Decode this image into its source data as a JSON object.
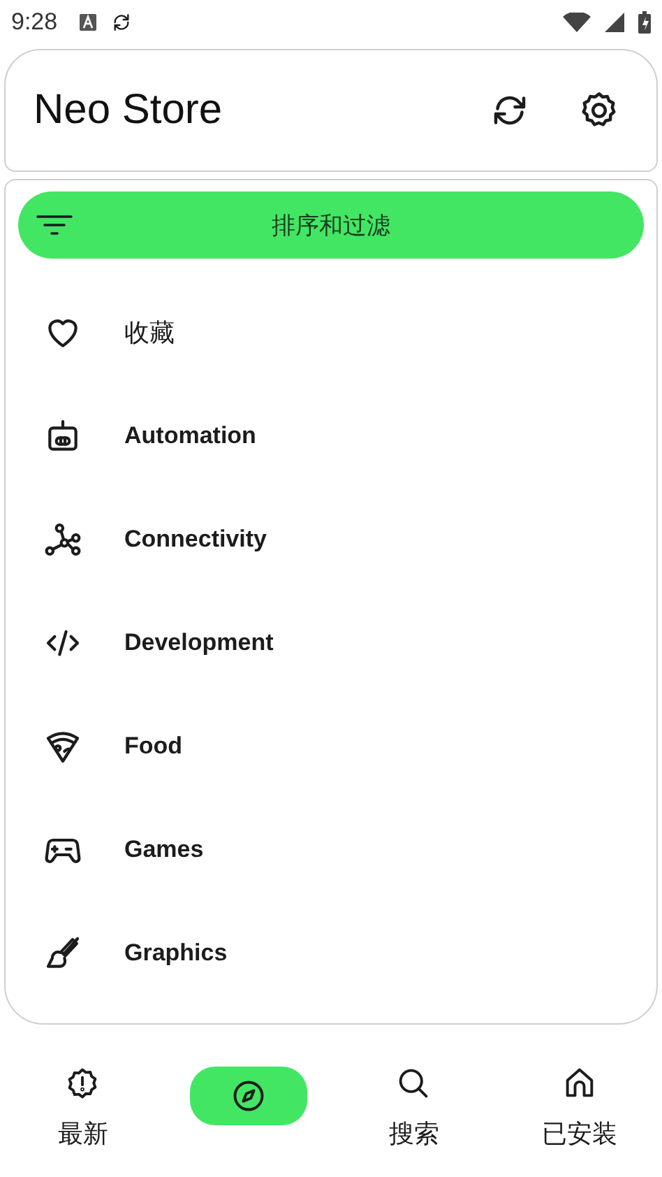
{
  "status_bar": {
    "time": "9:28"
  },
  "app_bar": {
    "title": "Neo Store"
  },
  "sort_button": {
    "label": "排序和过滤"
  },
  "categories": [
    {
      "label": "收藏"
    },
    {
      "label": "Automation"
    },
    {
      "label": "Connectivity"
    },
    {
      "label": "Development"
    },
    {
      "label": "Food"
    },
    {
      "label": "Games"
    },
    {
      "label": "Graphics"
    }
  ],
  "nav": [
    {
      "label": "最新",
      "selected": false
    },
    {
      "selected": true
    },
    {
      "label": "搜索",
      "selected": false
    },
    {
      "label": "已安装",
      "selected": false
    }
  ]
}
